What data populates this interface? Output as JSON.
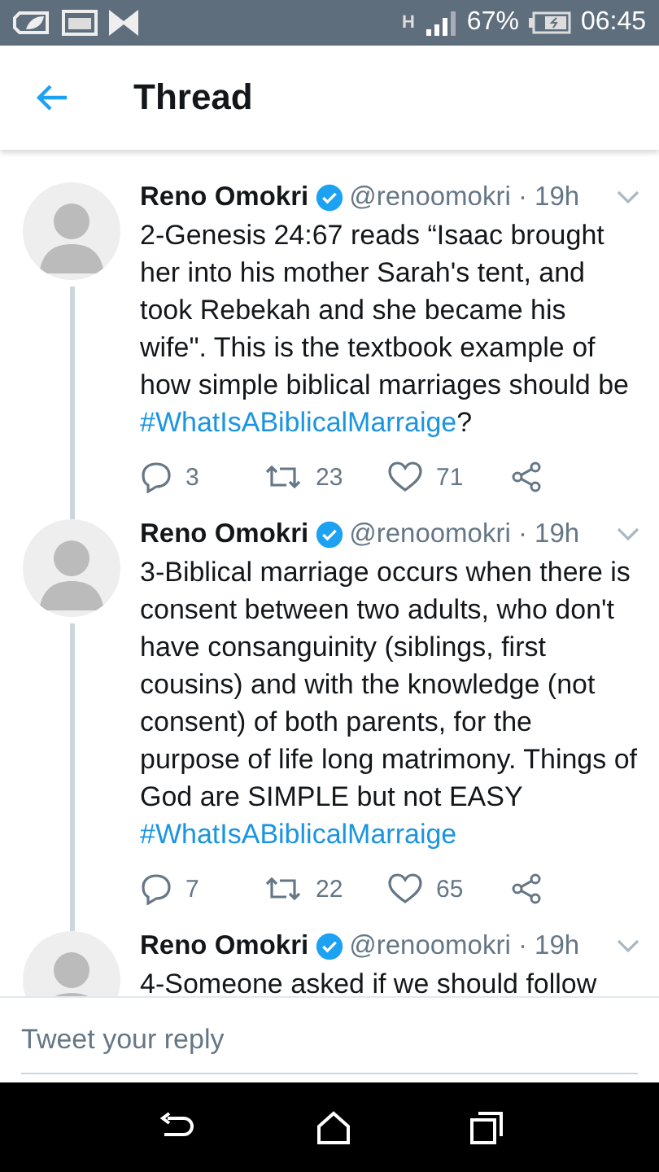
{
  "status_bar": {
    "network": "H",
    "battery": "67%",
    "time": "06:45"
  },
  "header": {
    "title": "Thread"
  },
  "tweets": [
    {
      "name": "Reno Omokri",
      "handle": "@renoomokri · 19h",
      "text": "2-Genesis 24:67 reads “Isaac brought her into his mother Sarah's tent, and took Rebekah and she became his wife\". This is the textbook example of how simple biblical marriages should be",
      "hashtag": "#WhatIsABiblicalMarraige",
      "after": "?",
      "replies": "3",
      "retweets": "23",
      "likes": "71"
    },
    {
      "name": "Reno Omokri",
      "handle": "@renoomokri · 19h",
      "text": "3-Biblical marriage occurs when there is consent between two adults, who don't have consanguinity (siblings, first cousins) and with the knowledge (not consent) of both parents, for the purpose of life long matrimony. Things of God are SIMPLE but not EASY",
      "hashtag": "#WhatIsABiblicalMarraige",
      "replies": "7",
      "retweets": "22",
      "likes": "65"
    },
    {
      "name": "Reno Omokri",
      "handle": "@renoomokri · 19h",
      "text": "4-Someone asked if we should follow"
    }
  ],
  "reply": {
    "placeholder": "Tweet your reply"
  }
}
